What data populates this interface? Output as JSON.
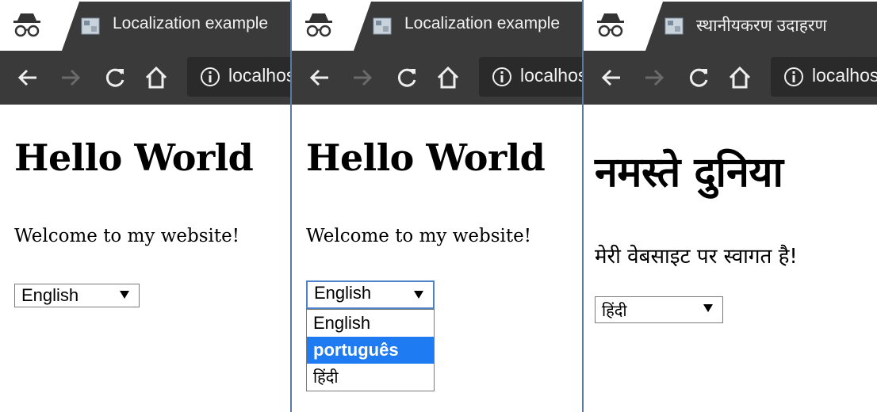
{
  "panels": [
    {
      "tab_title": "Localization example",
      "url": "localhost",
      "heading": "Hello World",
      "welcome": "Welcome to my website!",
      "select_value": "English"
    },
    {
      "tab_title": "Localization example",
      "url": "localhost",
      "heading": "Hello World",
      "welcome": "Welcome to my website!",
      "select_value": "English",
      "options": [
        {
          "label": "English",
          "selected": false
        },
        {
          "label": "português",
          "selected": true
        },
        {
          "label": "हिंदी",
          "selected": false
        }
      ]
    },
    {
      "tab_title": "स्थानीयकरण उदाहरण",
      "url": "localhost",
      "heading": "नमस्ते दुनिया",
      "welcome": "मेरी वेबसाइट पर स्वागत है!",
      "select_value": "हिंदी"
    }
  ],
  "icons": {
    "incognito": "incognito-icon",
    "favicon": "page-favicon-icon",
    "back": "back-arrow-icon",
    "forward": "forward-arrow-icon",
    "reload": "reload-icon",
    "home": "home-icon",
    "info": "info-icon",
    "dropdown": "chevron-down-icon"
  },
  "colors": {
    "toolbar": "#3a3a3a",
    "focus_border": "#4d82c8",
    "option_highlight": "#1e7bf2",
    "divider": "#5a7aa0"
  }
}
